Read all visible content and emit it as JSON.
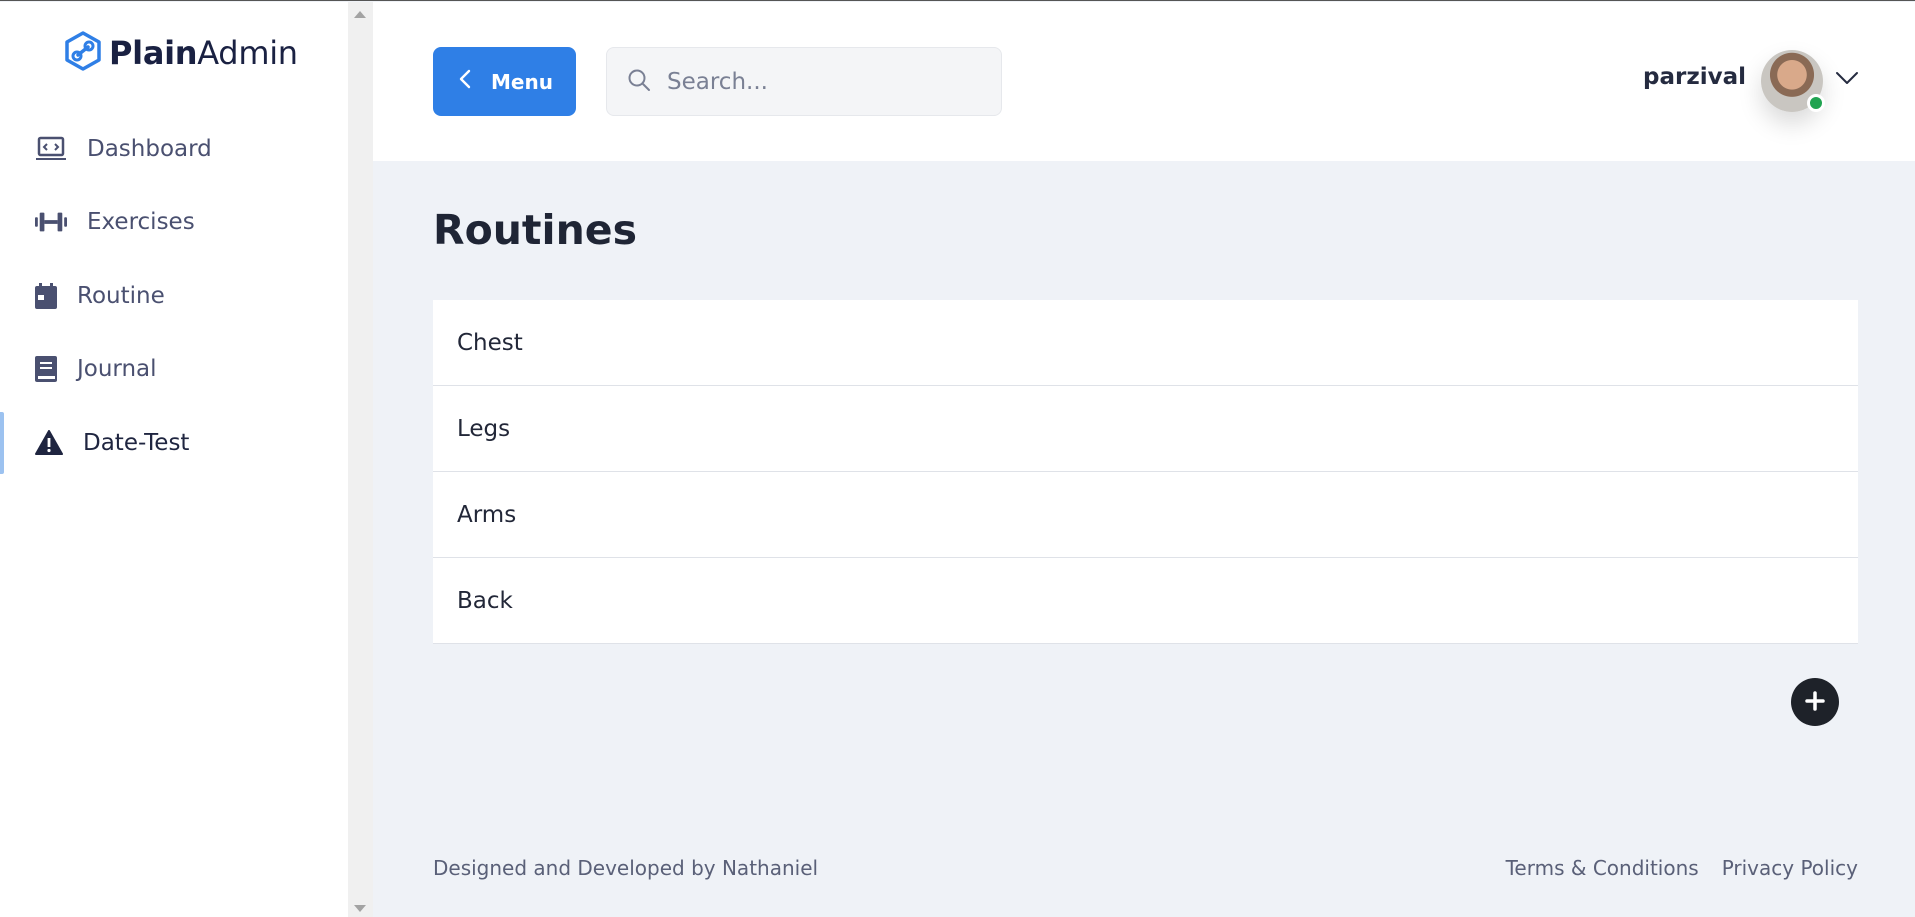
{
  "brand": {
    "name_bold": "Plain",
    "name_light": "Admin",
    "accent": "#2f7fe6"
  },
  "sidebar": {
    "items": [
      {
        "label": "Dashboard",
        "icon": "laptop-code-icon"
      },
      {
        "label": "Exercises",
        "icon": "dumbbell-icon"
      },
      {
        "label": "Routine",
        "icon": "calendar-icon"
      },
      {
        "label": "Journal",
        "icon": "book-icon"
      },
      {
        "label": "Date-Test",
        "icon": "warning-icon",
        "active": true
      }
    ]
  },
  "header": {
    "menu_label": "Menu",
    "search_placeholder": "Search...",
    "username": "parzival",
    "status_color": "#20a350"
  },
  "main": {
    "title": "Routines",
    "routines": [
      "Chest",
      "Legs",
      "Arms",
      "Back"
    ],
    "add_icon": "plus-icon"
  },
  "footer": {
    "credit": "Designed and Developed by Nathaniel",
    "links": [
      "Terms & Conditions",
      "Privacy Policy"
    ]
  }
}
